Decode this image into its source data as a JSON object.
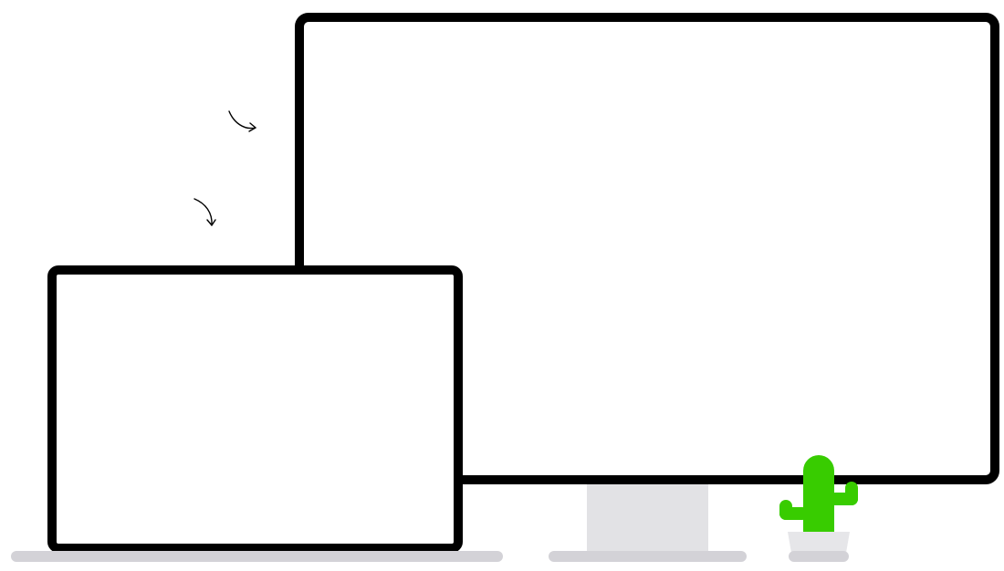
{
  "illustration": {
    "icons": [
      "curved-arrow-icon",
      "monitor-icon",
      "laptop-icon",
      "cactus-icon"
    ],
    "colors": {
      "outline": "#000000",
      "screen": "#ffffff",
      "stand": "#e2e2e5",
      "base": "#d3d2d7",
      "cactus": "#38cc00",
      "pot": "#e6e6e9",
      "pot_rim": "#d3d2d7",
      "background": "#ffffff"
    }
  }
}
